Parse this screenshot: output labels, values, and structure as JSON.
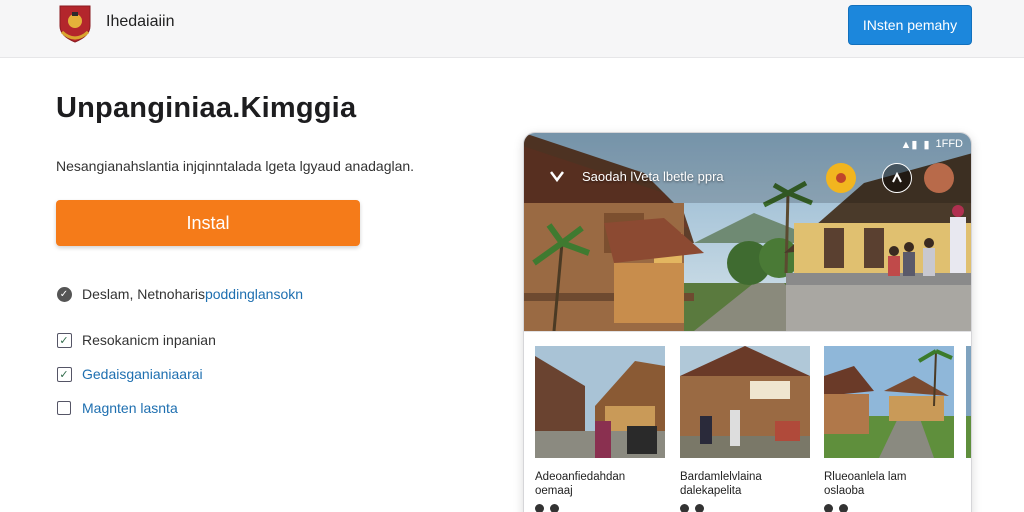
{
  "header": {
    "brand": "Ihedaiaiin",
    "cta_label": "INsten pemahy",
    "logo_icon": "crest-logo"
  },
  "hero": {
    "headline": "Unpanginiaa.Kimggia",
    "subtitle": "Nesangianahslantia injqinntalada lgeta lgyaud anadaglan.",
    "install_label": "Instal"
  },
  "features": [
    {
      "label": "Deslam, Netnoharis ",
      "link": "poddinglansokn",
      "icon": "check-circle-icon"
    },
    {
      "label": "Resokanicm inpanian",
      "icon": "checkbox-checked-icon"
    },
    {
      "label": "Gedaisganianiaarai",
      "icon": "checkbox-checked-icon"
    },
    {
      "label": "Magnten lasnta",
      "icon": "checkbox-empty-icon"
    }
  ],
  "phone": {
    "status_time": "1FFD",
    "app_title": "Saodah lVeta  lbetle ppra",
    "cards": [
      {
        "title": "Adeoanfiedahdan",
        "sub": "oemaaj"
      },
      {
        "title": "Bardamlelvlaina",
        "sub": "dalekapelita"
      },
      {
        "title": "Rlueoanlela lam",
        "sub": "oslaoba"
      }
    ]
  },
  "colors": {
    "accent_blue": "#1c87dc",
    "install_orange": "#f57b19",
    "link_blue": "#1e6fb0"
  }
}
